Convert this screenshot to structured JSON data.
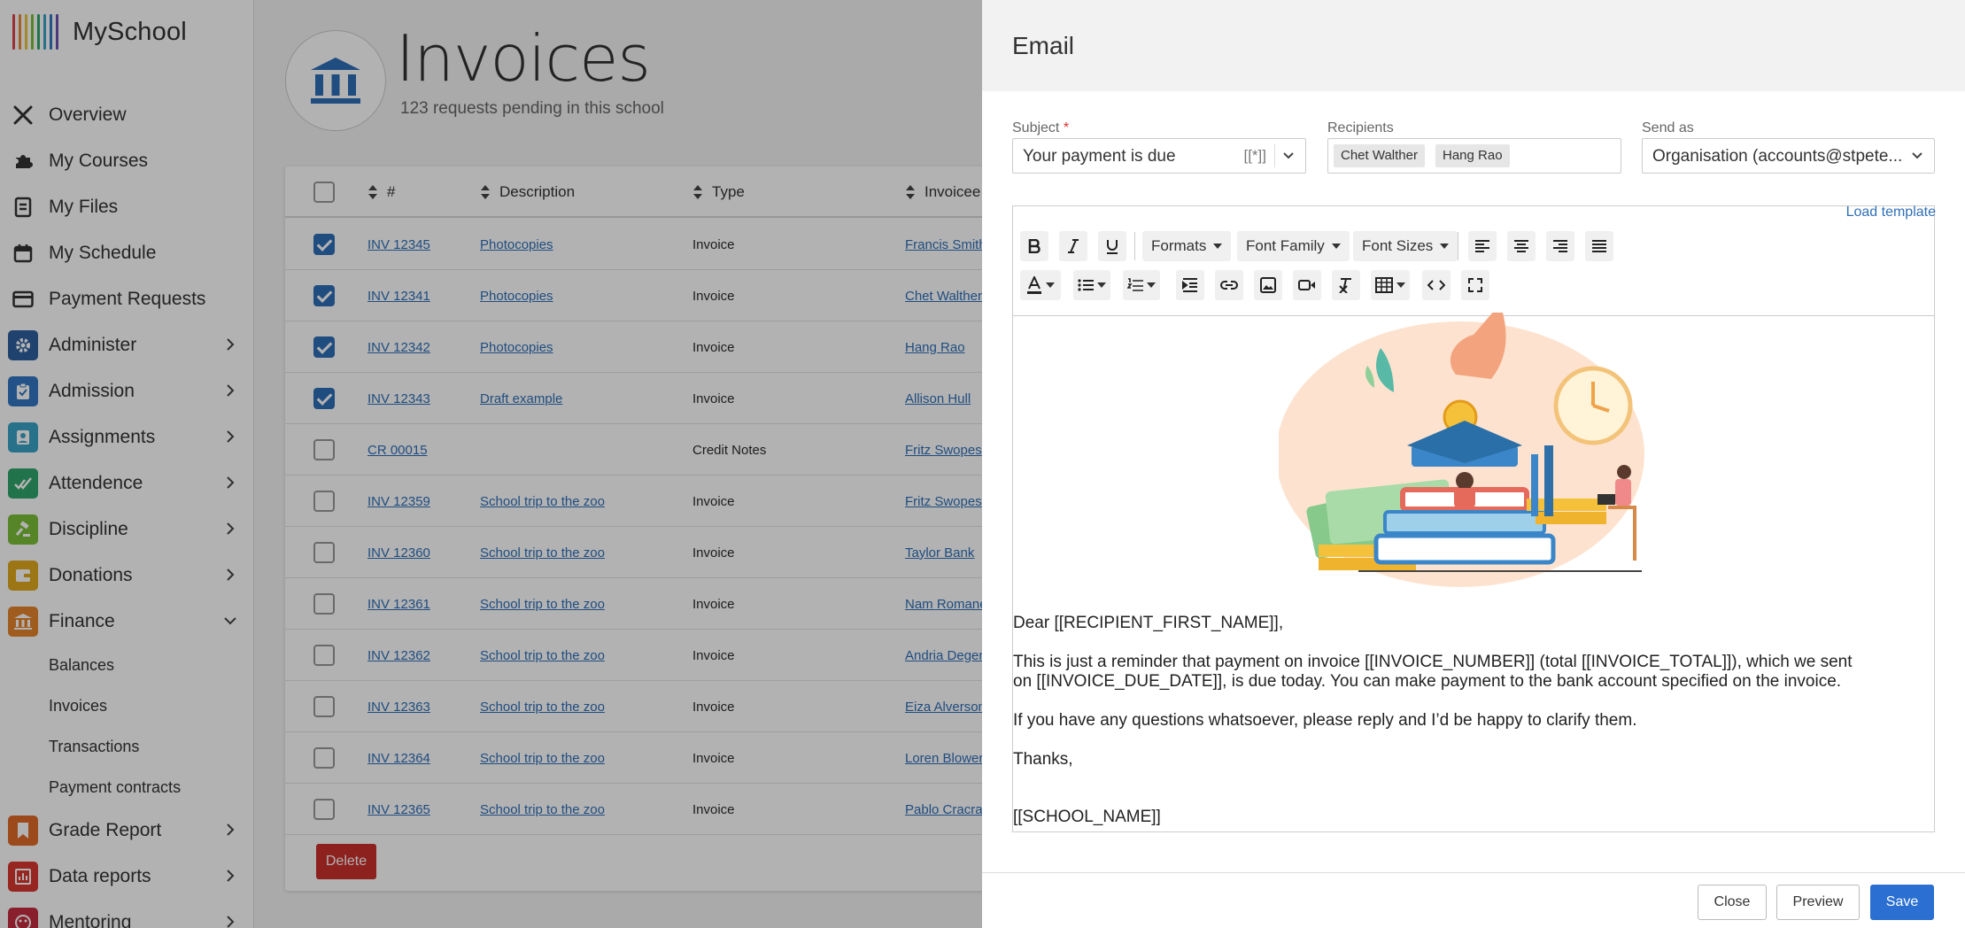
{
  "app": {
    "name": "MySchool"
  },
  "sidebar": {
    "items": [
      {
        "label": "Overview",
        "icon": "tools-icon"
      },
      {
        "label": "My Courses",
        "icon": "puzzle-icon"
      },
      {
        "label": "My Files",
        "icon": "file-icon"
      },
      {
        "label": "My Schedule",
        "icon": "calendar-icon"
      },
      {
        "label": "Payment Requests",
        "icon": "card-icon"
      },
      {
        "label": "Administer",
        "icon": "gear-icon",
        "color": "#2f5f9e"
      },
      {
        "label": "Admission",
        "icon": "clipboard-icon",
        "color": "#3276c3"
      },
      {
        "label": "Assignments",
        "icon": "badge-icon",
        "color": "#3aa3c7"
      },
      {
        "label": "Attendence",
        "icon": "check-icon",
        "color": "#2ea56a"
      },
      {
        "label": "Discipline",
        "icon": "gavel-icon",
        "color": "#7bbf3a"
      },
      {
        "label": "Donations",
        "icon": "wallet-icon",
        "color": "#e0a81f"
      },
      {
        "label": "Finance",
        "icon": "bank-icon",
        "color": "#e4842b"
      },
      {
        "label": "Grade Report",
        "icon": "bookmark-icon",
        "color": "#e06a27"
      },
      {
        "label": "Data reports",
        "icon": "chart-icon",
        "color": "#d8352f"
      },
      {
        "label": "Mentoring",
        "icon": "people-icon",
        "color": "#c42c3f"
      }
    ],
    "finance_sub": [
      "Balances",
      "Invoices",
      "Transactions",
      "Payment contracts"
    ]
  },
  "page": {
    "title": "Invoices",
    "subtitle": "123 requests pending in this school"
  },
  "table": {
    "headers": [
      "#",
      "Description",
      "Type",
      "Invoicee"
    ],
    "rows": [
      {
        "checked": true,
        "number": "INV 12345",
        "description": "Photocopies",
        "type": "Invoice",
        "invoicee": "Francis Smith"
      },
      {
        "checked": true,
        "number": "INV 12341",
        "description": "Photocopies",
        "type": "Invoice",
        "invoicee": "Chet Walther"
      },
      {
        "checked": true,
        "number": "INV 12342",
        "description": "Photocopies",
        "type": "Invoice",
        "invoicee": "Hang Rao"
      },
      {
        "checked": true,
        "number": "INV 12343",
        "description": "Draft example",
        "type": "Invoice",
        "invoicee": "Allison Hull"
      },
      {
        "checked": false,
        "number": "CR 00015",
        "description": "",
        "type": "Credit Notes",
        "invoicee": "Fritz Swopes"
      },
      {
        "checked": false,
        "number": "INV 12359",
        "description": "School trip to the zoo",
        "type": "Invoice",
        "invoicee": "Fritz Swopes"
      },
      {
        "checked": false,
        "number": "INV 12360",
        "description": "School trip to the zoo",
        "type": "Invoice",
        "invoicee": "Taylor Bank"
      },
      {
        "checked": false,
        "number": "INV 12361",
        "description": "School trip to the zoo",
        "type": "Invoice",
        "invoicee": "Nam Romane"
      },
      {
        "checked": false,
        "number": "INV 12362",
        "description": "School trip to the zoo",
        "type": "Invoice",
        "invoicee": "Andria Degen"
      },
      {
        "checked": false,
        "number": "INV 12363",
        "description": "School trip to the zoo",
        "type": "Invoice",
        "invoicee": "Eiza Alverson"
      },
      {
        "checked": false,
        "number": "INV 12364",
        "description": "School trip to the zoo",
        "type": "Invoice",
        "invoicee": "Loren Blower"
      },
      {
        "checked": false,
        "number": "INV 12365",
        "description": "School trip to the zoo",
        "type": "Invoice",
        "invoicee": "Pablo Cracraft"
      }
    ],
    "delete_label": "Delete"
  },
  "modal": {
    "title": "Email",
    "subject_label": "Subject",
    "required_mark": "*",
    "subject_value": "Your payment is due",
    "subject_token": "[[*]]",
    "recipients_label": "Recipients",
    "recipients": [
      "Chet Walther",
      "Hang Rao"
    ],
    "send_as_label": "Send as",
    "send_as_value": "Organisation (accounts@stpete...",
    "load_template": "Load template",
    "toolbar": {
      "formats": "Formats",
      "font_family": "Font Family",
      "font_sizes": "Font Sizes"
    },
    "body": {
      "greeting": "Dear [[RECIPIENT_FIRST_NAME]],",
      "para1": "This is just a reminder that payment on invoice [[INVOICE_NUMBER]] (total [[INVOICE_TOTAL]]), which we sent on [[INVOICE_DUE_DATE]], is due today. You can make payment to the bank account specified on the invoice.",
      "para2": "If you have any questions whatsoever, please reply and I’d be happy to clarify them.",
      "thanks": "Thanks,",
      "signature": "[[SCHOOL_NAME]]"
    },
    "buttons": {
      "close": "Close",
      "preview": "Preview",
      "save": "Save"
    }
  },
  "colors": {
    "accent": "#2a6fd1",
    "link": "#2f6fb8",
    "danger": "#c9302c",
    "overlay": "rgba(0,0,0,0.3)"
  }
}
